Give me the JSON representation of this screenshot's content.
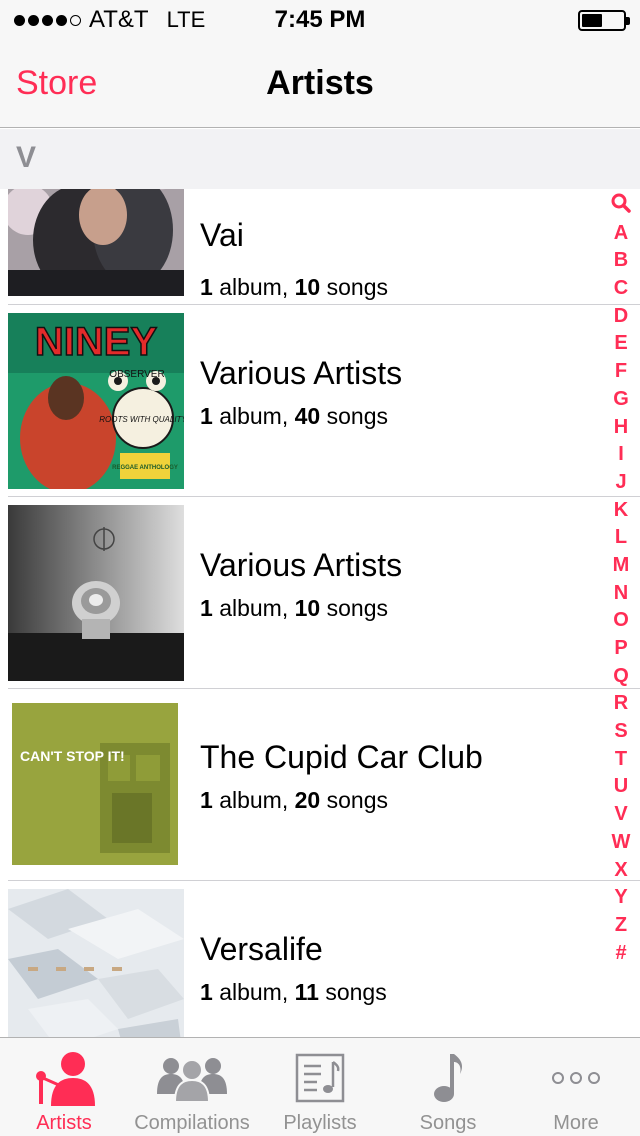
{
  "status": {
    "carrier": "AT&T",
    "network": "LTE",
    "time": "7:45 PM"
  },
  "nav": {
    "back_label": "Store",
    "title": "Artists"
  },
  "section": {
    "letter": "V"
  },
  "artists": [
    {
      "name": "Vai",
      "albums": "1",
      "album_word": "album,",
      "songs": "10",
      "song_word": "songs"
    },
    {
      "name": "Various Artists",
      "albums": "1",
      "album_word": "album,",
      "songs": "40",
      "song_word": "songs"
    },
    {
      "name": "Various Artists",
      "albums": "1",
      "album_word": "album,",
      "songs": "10",
      "song_word": "songs"
    },
    {
      "name": "The Cupid Car Club",
      "albums": "1",
      "album_word": "album,",
      "songs": "20",
      "song_word": "songs"
    },
    {
      "name": "Versalife",
      "albums": "1",
      "album_word": "album,",
      "songs": "11",
      "song_word": "songs"
    }
  ],
  "artwork": {
    "niney_title": "NINEY",
    "niney_observer": "OBSERVER",
    "niney_roots": "ROOTS WITH QUALITY",
    "niney_reggae": "REGGAE ANTHOLOGY",
    "cupid_title": "CAN'T STOP IT!"
  },
  "index": [
    "search-icon",
    "A",
    "B",
    "C",
    "D",
    "E",
    "F",
    "G",
    "H",
    "I",
    "J",
    "K",
    "L",
    "M",
    "N",
    "O",
    "P",
    "Q",
    "R",
    "S",
    "T",
    "U",
    "V",
    "W",
    "X",
    "Y",
    "Z",
    "#"
  ],
  "tabs": [
    {
      "label": "Artists",
      "icon": "artists-icon",
      "active": true
    },
    {
      "label": "Compilations",
      "icon": "compilations-icon",
      "active": false
    },
    {
      "label": "Playlists",
      "icon": "playlists-icon",
      "active": false
    },
    {
      "label": "Songs",
      "icon": "songs-icon",
      "active": false
    },
    {
      "label": "More",
      "icon": "more-icon",
      "active": false
    }
  ],
  "colors": {
    "accent": "#ff2d55",
    "inactive": "#929292",
    "section_bg": "#f2f2f4"
  }
}
